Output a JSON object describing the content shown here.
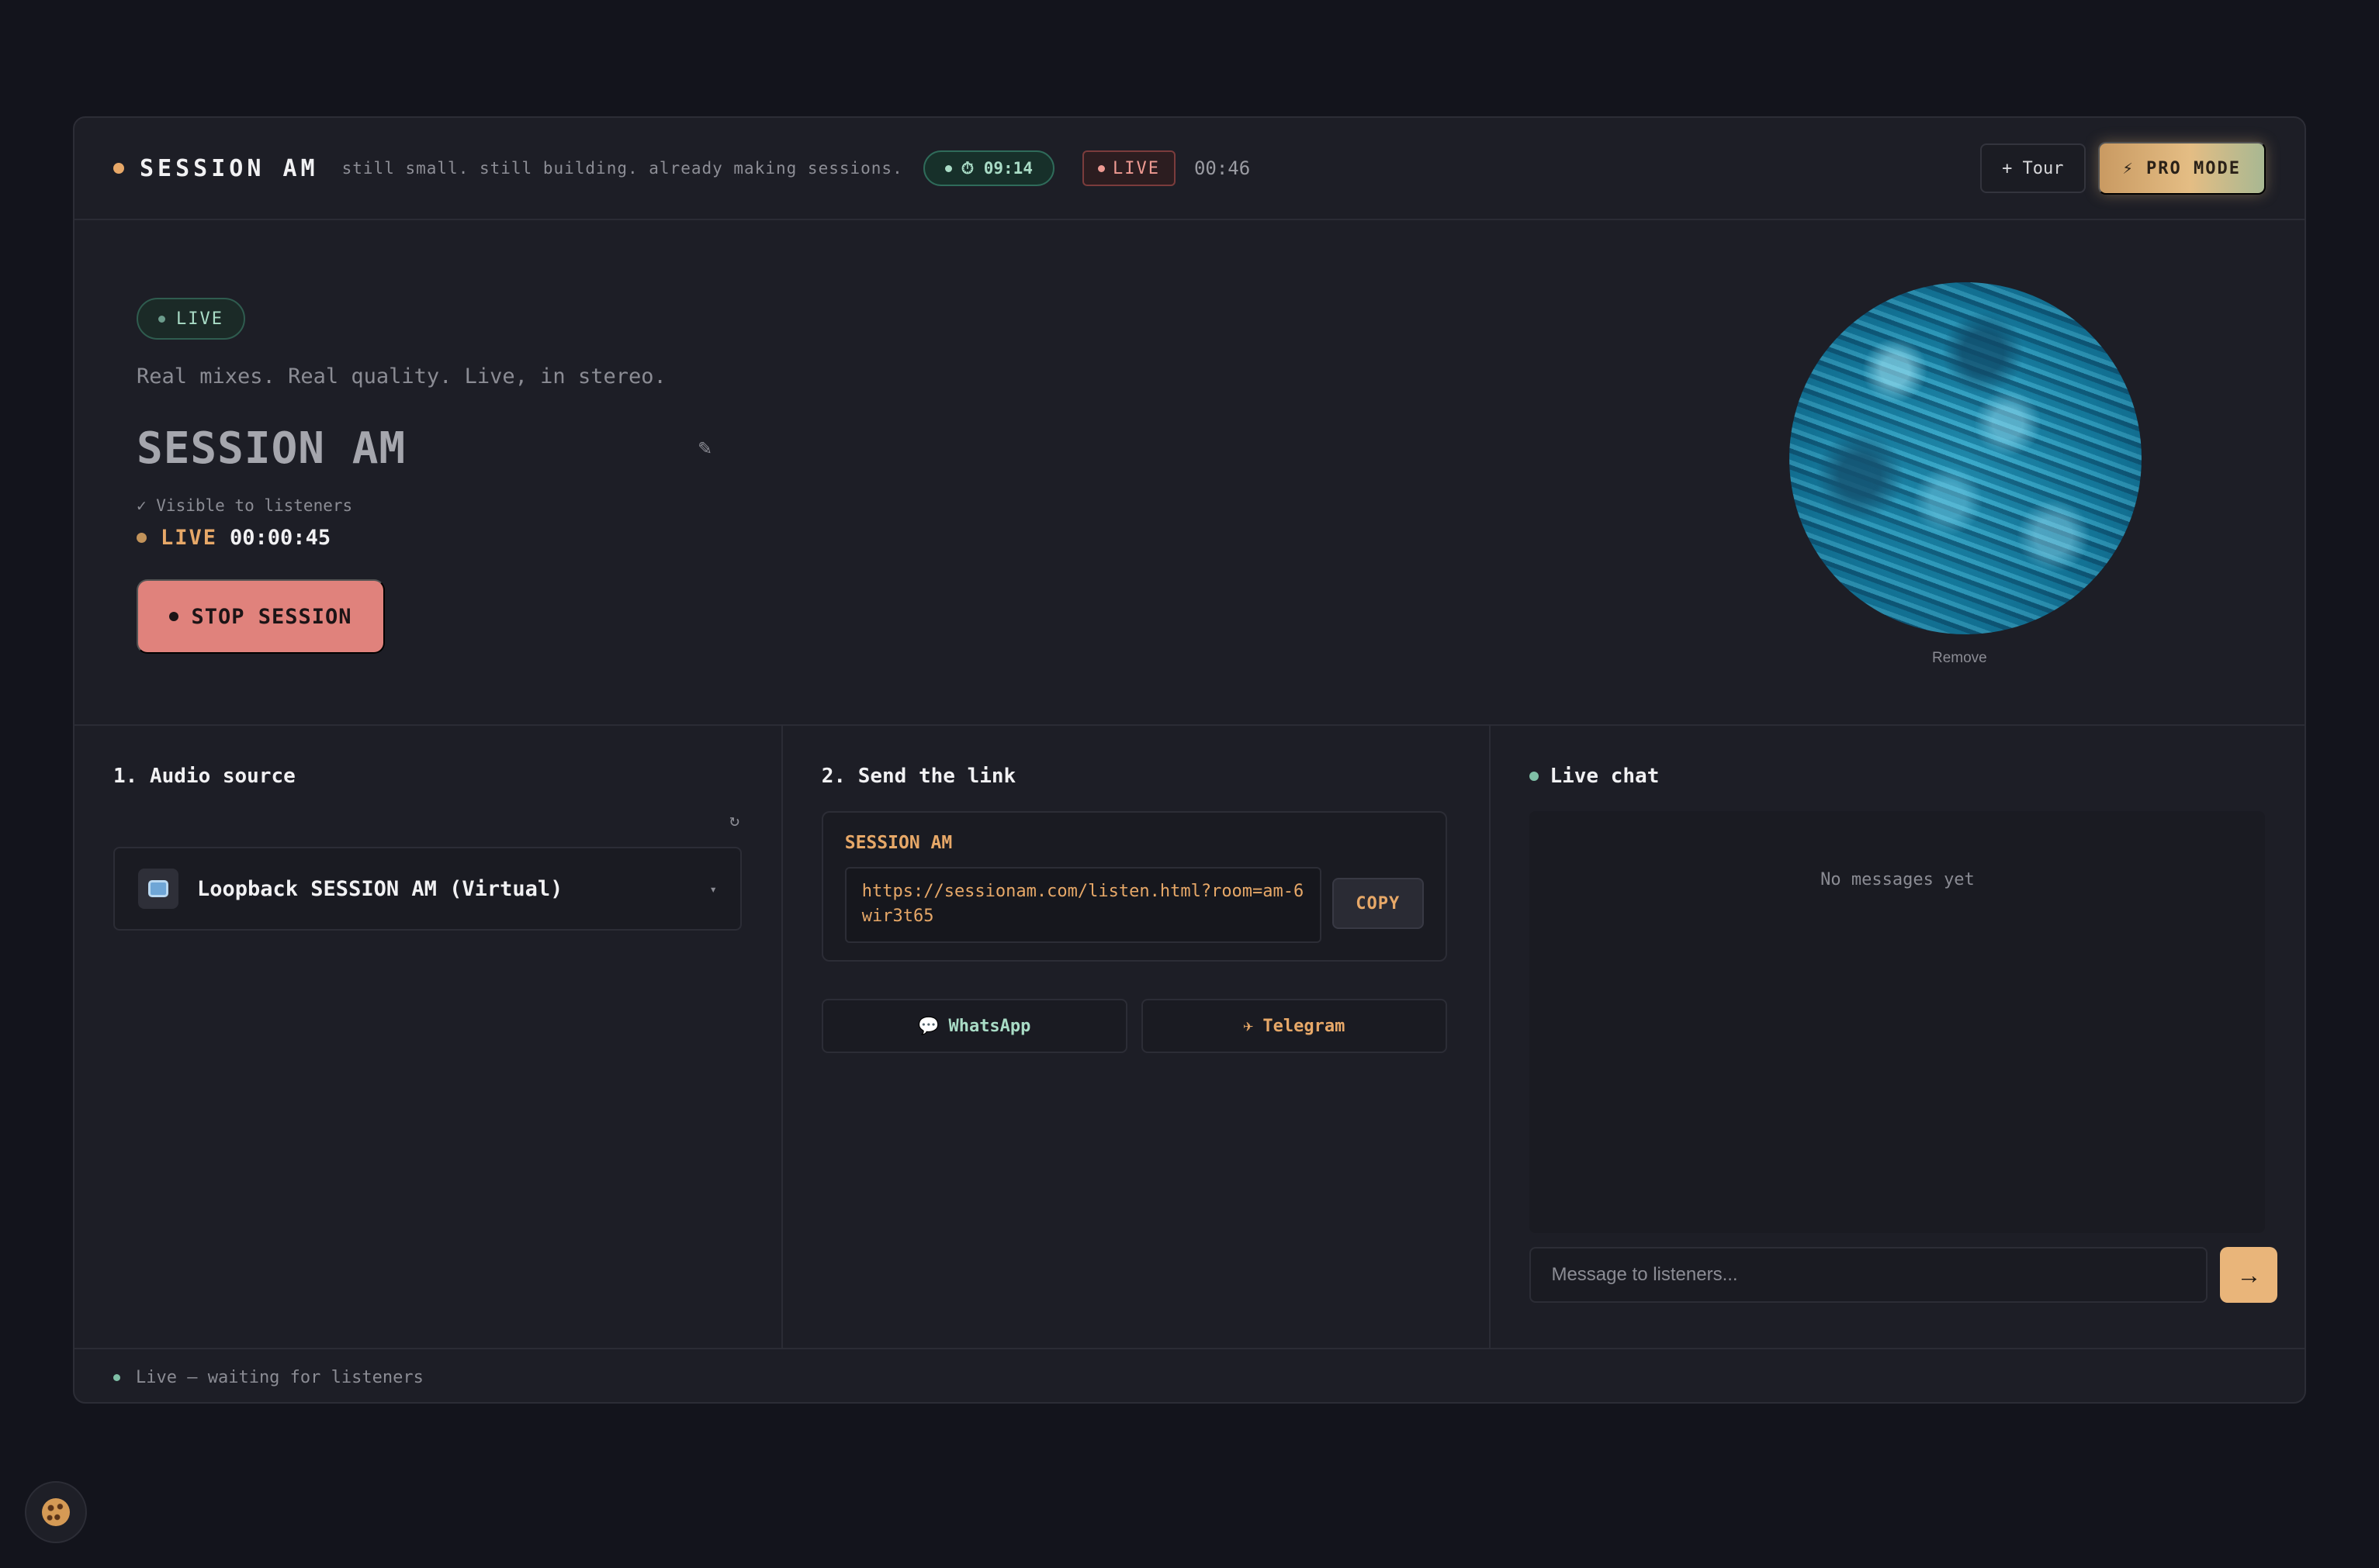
{
  "header": {
    "brand": "SESSION AM",
    "tagline": "still small. still building. already making sessions.",
    "timer": "⏱ 09:14",
    "live_label": "LIVE",
    "elapsed": "00:46",
    "tour_label": "+ Tour",
    "pro_label": "⚡ PRO MODE"
  },
  "hero": {
    "live_badge": "LIVE",
    "subtitle": "Real mixes. Real quality. Live, in stereo.",
    "title": "SESSION AM",
    "edit_icon": "✎",
    "visible_note": "✓ Visible to listeners",
    "live_label": "LIVE",
    "live_time": "00:00:45",
    "stop_label": "STOP SESSION",
    "remove_label": "Remove"
  },
  "audio": {
    "title": "1. Audio source",
    "refresh_icon": "↻",
    "source_name": "Loopback SESSION AM (Virtual)",
    "chevron": "▾"
  },
  "link": {
    "title": "2. Send the link",
    "session_name": "SESSION AM",
    "url": "https://sessionam.com/listen.html?room=am-6wir3t65",
    "copy_label": "COPY",
    "whatsapp_icon": "💬",
    "whatsapp_label": "WhatsApp",
    "telegram_icon": "✈",
    "telegram_label": "Telegram"
  },
  "chat": {
    "title": "Live chat",
    "empty_text": "No messages yet",
    "input_placeholder": "Message to listeners...",
    "send_label": "→"
  },
  "footer": {
    "status": "Live — waiting for listeners"
  },
  "icons": {
    "cookie": "cookie-icon",
    "source": "loopback-icon"
  },
  "colors": {
    "accent": "#e7a868",
    "live_green": "#a9dcc6",
    "stop_red": "#e0827c",
    "background": "#13141c",
    "panel": "#1d1e26"
  }
}
